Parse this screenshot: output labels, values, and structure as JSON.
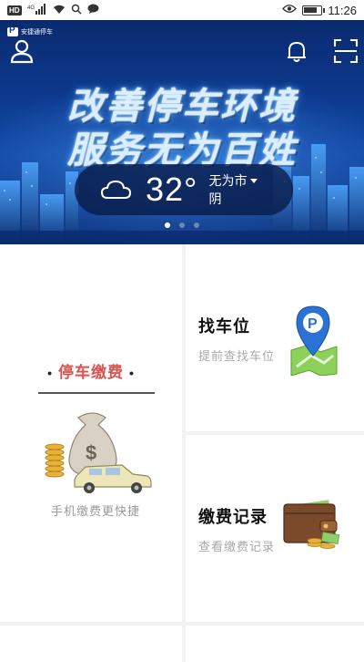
{
  "status_bar": {
    "left_badge": "HD",
    "signal_label": "4G",
    "time": "11:26",
    "battery_level_percent": 80
  },
  "banner": {
    "brand": "安捷通停车",
    "slogan_line1": "改善停车环境",
    "slogan_line2": "服务无为百姓",
    "weather": {
      "temperature": "32°",
      "city": "无为市",
      "condition": "阴",
      "icon": "cloud-icon"
    },
    "carousel_pages": 3,
    "carousel_active_index": 0,
    "top_icons": [
      "user-icon",
      "bell-icon",
      "scan-icon"
    ]
  },
  "features": {
    "parking_payment": {
      "title": "停车缴费",
      "subtitle": "手机缴费更快捷",
      "accent_color": "#d9534f"
    },
    "find_space": {
      "title": "找车位",
      "subtitle": "提前查找车位"
    },
    "payment_records": {
      "title": "缴费记录",
      "subtitle": "查看缴费记录"
    }
  },
  "colors": {
    "banner_blue": "#0d3a8f",
    "pay_red": "#d9534f",
    "map_blue": "#2a72d6",
    "map_green": "#6fbf3f",
    "wallet_brown": "#7b4a2a"
  }
}
